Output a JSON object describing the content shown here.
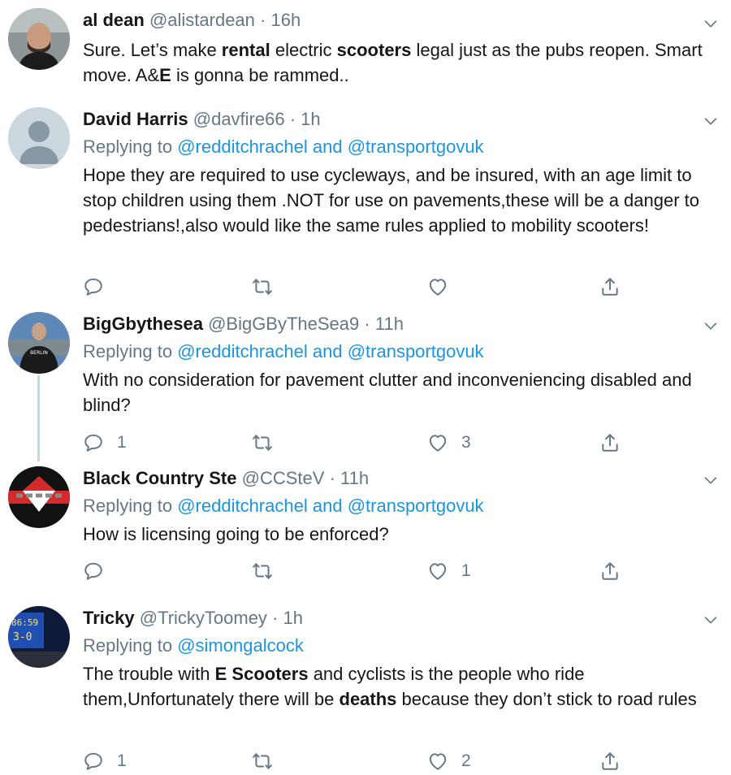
{
  "tweets": [
    {
      "name": "al dean",
      "handle": "@alistardean",
      "time": "16h",
      "body": [
        "Sure. Let’s make ",
        "rental",
        " electric ",
        "scooters",
        " legal just as the pubs reopen. Smart move. A&",
        "E",
        " is gonna be rammed.."
      ]
    },
    {
      "name": "David Harris",
      "handle": "@davfire66",
      "time": "1h",
      "replying_to": "Replying to",
      "reply_users": [
        "@redditchrachel",
        "and",
        "@transportgovuk"
      ],
      "body_text": "Hope they are required to use cycleways, and be insured, with  an age limit to stop children using them .NOT for use on pavements,these will be a danger to pedestrians!,also would like the same rules applied to mobility scooters!",
      "reply_count": "",
      "like_count": ""
    },
    {
      "name": "BigGbythesea",
      "handle": "@BigGByTheSea9",
      "time": "11h",
      "replying_to": "Replying to",
      "reply_users": [
        "@redditchrachel",
        "and",
        "@transportgovuk"
      ],
      "body_text": "With no consideration for pavement clutter and inconveniencing disabled and blind?",
      "reply_count": "1",
      "like_count": "3"
    },
    {
      "name": "Black Country Ste",
      "handle": "@CCSteV",
      "time": "11h",
      "replying_to": "Replying to",
      "reply_users": [
        "@redditchrachel",
        "and",
        "@transportgovuk"
      ],
      "body_text": "How is licensing going to be enforced?",
      "reply_count": "",
      "like_count": "1"
    },
    {
      "name": "Tricky",
      "handle": "@TrickyToomey",
      "time": "1h",
      "replying_to": "Replying to",
      "reply_users": [
        "@simongalcock"
      ],
      "body": [
        "The trouble with ",
        "E Scooters",
        " and cyclists is the people who ride them,Unfortunately there will be ",
        "deaths",
        " because they don’t stick to road rules"
      ],
      "reply_count": "1",
      "like_count": "2"
    }
  ],
  "avatar5_text": [
    "86:59",
    "3-0"
  ],
  "avatar2_text": "BERLIN",
  "separator": "·",
  "colors": {
    "link": "#1b95e0",
    "muted": "#657786",
    "text": "#14171a"
  },
  "icons": [
    "reply-icon",
    "retweet-icon",
    "like-icon",
    "share-icon",
    "chevron-down-icon"
  ]
}
